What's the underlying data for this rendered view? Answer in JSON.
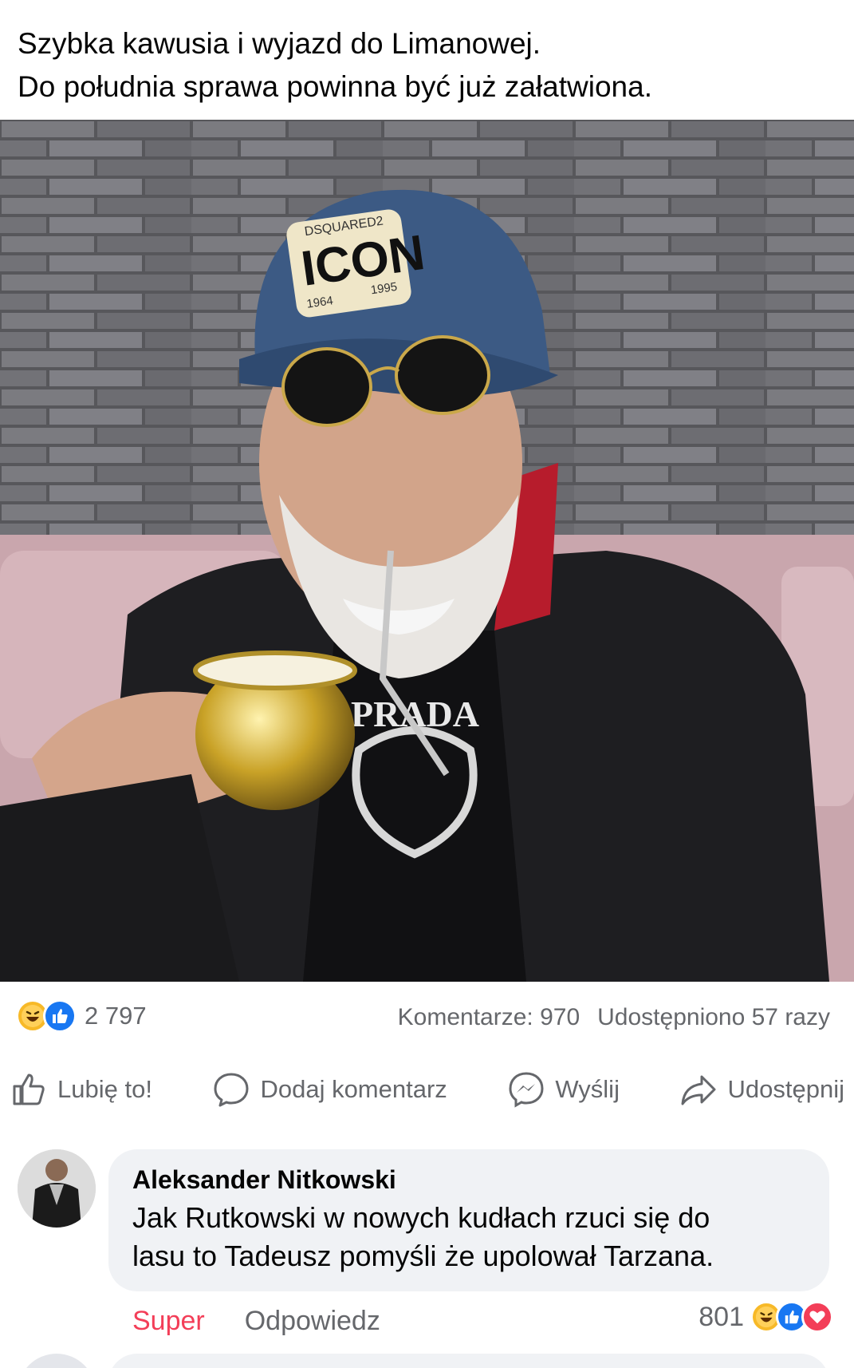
{
  "post": {
    "text_line1": "Szybka kawusia i wyjazd do Limanowej.",
    "text_line2": "Do południa sprawa powinna być już załatwiona.",
    "photo": {
      "cap_patch_brand": "DSQUARED2",
      "cap_patch_title": "ICON",
      "cap_patch_year_left": "1964",
      "cap_patch_year_right": "1995",
      "shirt_print": "PRADA"
    }
  },
  "stats": {
    "reaction_icons": [
      "haha-icon",
      "like-icon"
    ],
    "reaction_count": "2 797",
    "comments": "Komentarze: 970",
    "shares": "Udostępniono 57 razy"
  },
  "actions": {
    "like": "Lubię to!",
    "comment": "Dodaj komentarz",
    "send": "Wyślij",
    "share": "Udostępnij"
  },
  "comment": {
    "author": "Aleksander Nitkowski",
    "text_line1": "Jak Rutkowski w nowych kudłach rzuci się do",
    "text_line2": "lasu to Tadeusz pomyśli że upolował Tarzana.",
    "reaction_label": "Super",
    "reply_label": "Odpowiedz",
    "likes": "801",
    "reaction_icons": [
      "haha-icon",
      "like-icon",
      "love-icon"
    ]
  },
  "colors": {
    "accent": "#1877f2",
    "secondary_text": "#65676b",
    "reaction_super": "#f33e58",
    "bubble": "#f0f2f5"
  }
}
